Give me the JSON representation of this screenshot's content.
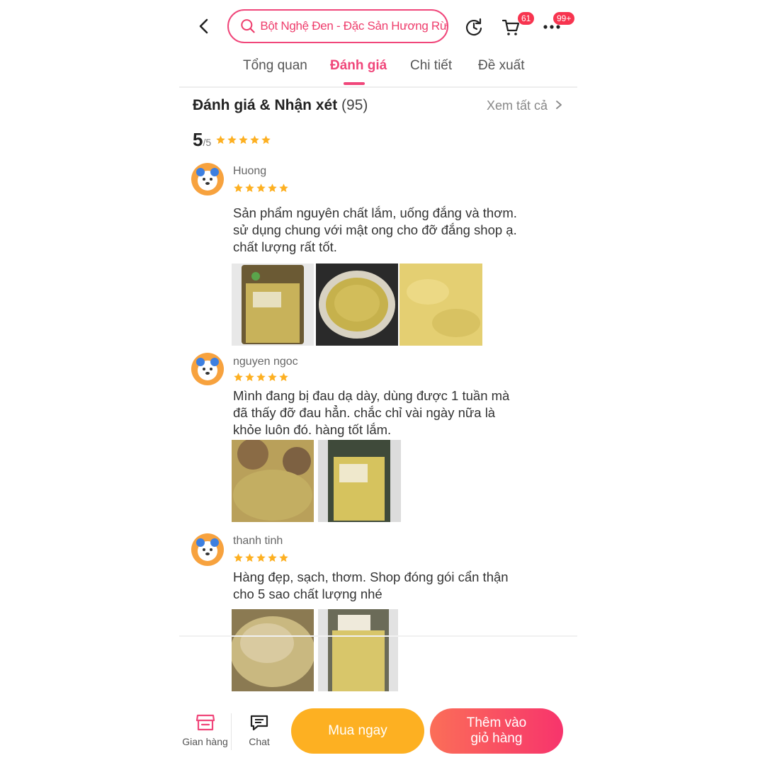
{
  "header": {
    "search_text": "Bột Nghệ Đen - Đặc Sản Hương Rừng",
    "cart_badge": "61",
    "more_badge": "99+"
  },
  "tabs": [
    {
      "label": "Tổng quan",
      "active": false
    },
    {
      "label": "Đánh giá",
      "active": true
    },
    {
      "label": "Chi tiết",
      "active": false
    },
    {
      "label": "Đề xuất",
      "active": false
    }
  ],
  "reviews_section": {
    "title": "Đánh giá & Nhận xét",
    "count": "(95)",
    "see_all": "Xem tất cả",
    "score": "5",
    "score_den": "/5",
    "score_stars": 5
  },
  "reviews": [
    {
      "name": "Huong",
      "stars": 5,
      "lines": [
        "Sản phẩm nguyên chất lắm, uống đắng và thơm.",
        "sử dụng chung với mật ong cho đỡ đắng shop ạ.",
        "chất lượng rất tốt."
      ],
      "photos": [
        "bag",
        "bowl",
        "powder"
      ]
    },
    {
      "name": "nguyen ngoc",
      "stars": 5,
      "lines": [
        "Mình đang bị đau dạ dày, dùng được 1 tuần mà",
        "đã thấy đỡ đau hẳn. chắc chỉ vài ngày nữa là",
        "khỏe luôn đó. hàng tốt lắm."
      ],
      "photos": [
        "slices",
        "bag"
      ]
    },
    {
      "name": "thanh tinh",
      "stars": 5,
      "lines": [
        "Hàng đẹp, sạch, thơm. Shop đóng gói cẩn thận",
        "cho 5 sao chất lượng nhé"
      ],
      "photos": [
        "heap",
        "bag"
      ]
    }
  ],
  "bottom_bar": {
    "shop_label": "Gian hàng",
    "chat_label": "Chat",
    "buy_label": "Mua ngay",
    "cart_line1": "Thêm vào",
    "cart_line2": "giỏ hàng"
  },
  "colors": {
    "accent": "#f0467a",
    "star": "#fdb022",
    "buy": "#fdb022",
    "cart_gradient": [
      "#fb6e58",
      "#f7346c"
    ]
  },
  "icons": [
    "back-arrow-icon",
    "search-icon",
    "history-icon",
    "cart-icon",
    "more-icon",
    "chevron-right-icon",
    "star-icon",
    "shop-icon",
    "chat-icon"
  ]
}
